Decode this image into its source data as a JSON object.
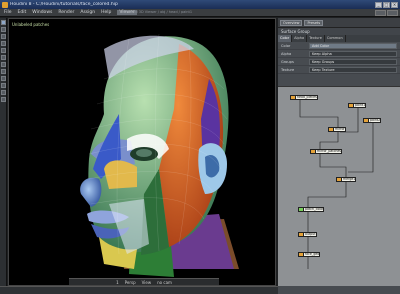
{
  "window": {
    "title": "Houdini 8 - C:/Houdini/tutorials/face_colored.hip"
  },
  "menu": {
    "items": [
      "File",
      "Edit",
      "Windows",
      "Render",
      "Assign",
      "Help",
      "Viewer"
    ],
    "active_index": 6
  },
  "statusline": "Unlabeled 3D Viewer / obj / head / paint1",
  "viewport": {
    "label": "Unlabeled patches",
    "bottom": [
      "1",
      "Persp",
      "View",
      "no cam"
    ]
  },
  "panel": {
    "top_dropdowns": [
      "Overview",
      "Presets"
    ],
    "header": "Surface Group",
    "tabs": [
      "Color",
      "Alpha",
      "Texture",
      "Common"
    ],
    "active_tab": 0,
    "rows": [
      {
        "label": "Color",
        "value": "Add Color"
      },
      {
        "label": "Alpha",
        "value": "Keep Alpha"
      },
      {
        "label": "Groups",
        "value": "Keep Groups"
      },
      {
        "label": "Texture",
        "value": "Keep Texture"
      }
    ]
  },
  "nodes": [
    {
      "label": "head_pieces"
    },
    {
      "label": "paint1"
    },
    {
      "label": "paint2"
    },
    {
      "label": "mirror"
    },
    {
      "label": "mirror_patches"
    },
    {
      "label": "merge1"
    },
    {
      "label": "patch_color"
    },
    {
      "label": "output"
    },
    {
      "label": "face_geo"
    }
  ],
  "colors": {
    "accent": "#2f4a78",
    "node_port": "#e5a33a",
    "node_port_active": "#7ad05c"
  }
}
